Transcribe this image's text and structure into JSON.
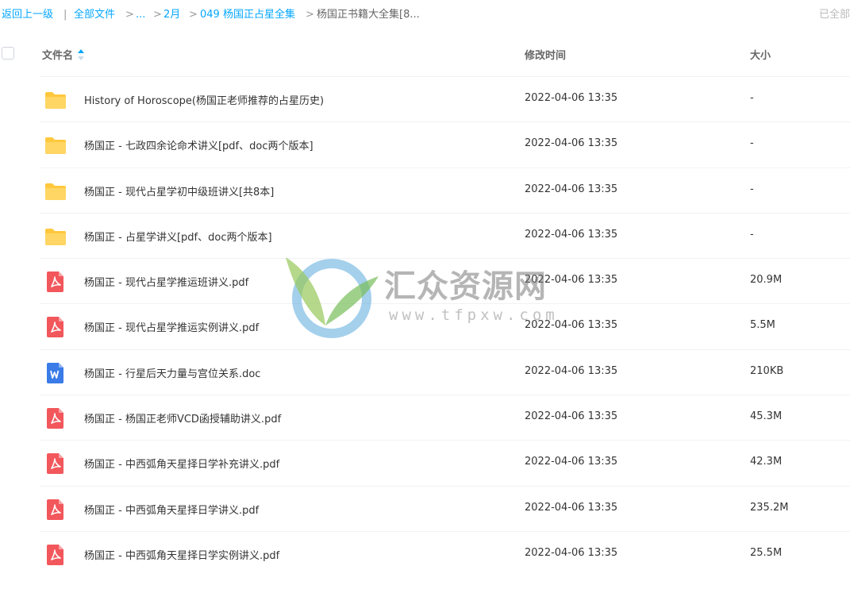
{
  "breadcrumb": {
    "back": "返回上一级",
    "divider": "|",
    "all_files": "全部文件",
    "ellipsis": "...",
    "month": "2月",
    "collection": "049 杨国正占星全集",
    "current": "杨国正书籍大全集[8...",
    "arrow": ">"
  },
  "selected_count_label": "已全部",
  "table": {
    "col_name": "文件名",
    "col_time": "修改时间",
    "col_size": "大小",
    "rows": [
      {
        "icon": "folder-icon",
        "name": "History of Horoscope(杨国正老师推荐的占星历史)",
        "time": "2022-04-06 13:35",
        "size": "-"
      },
      {
        "icon": "folder-icon",
        "name": "杨国正 - 七政四余论命术讲义[pdf、doc两个版本]",
        "time": "2022-04-06 13:35",
        "size": "-"
      },
      {
        "icon": "folder-icon",
        "name": "杨国正 - 现代占星学初中级班讲义[共8本]",
        "time": "2022-04-06 13:35",
        "size": "-"
      },
      {
        "icon": "folder-icon",
        "name": "杨国正 - 占星学讲义[pdf、doc两个版本]",
        "time": "2022-04-06 13:35",
        "size": "-"
      },
      {
        "icon": "pdf-icon",
        "name": "杨国正 - 现代占星学推运班讲义.pdf",
        "time": "2022-04-06 13:35",
        "size": "20.9M"
      },
      {
        "icon": "pdf-icon",
        "name": "杨国正 - 现代占星学推运实例讲义.pdf",
        "time": "2022-04-06 13:35",
        "size": "5.5M"
      },
      {
        "icon": "doc-icon",
        "name": "杨国正 - 行星后天力量与宫位关系.doc",
        "time": "2022-04-06 13:35",
        "size": "210KB"
      },
      {
        "icon": "pdf-icon",
        "name": "杨国正 - 杨国正老师VCD函授辅助讲义.pdf",
        "time": "2022-04-06 13:35",
        "size": "45.3M"
      },
      {
        "icon": "pdf-icon",
        "name": "杨国正 - 中西弧角天星择日学补充讲义.pdf",
        "time": "2022-04-06 13:35",
        "size": "42.3M"
      },
      {
        "icon": "pdf-icon",
        "name": "杨国正 - 中西弧角天星择日学讲义.pdf",
        "time": "2022-04-06 13:35",
        "size": "235.2M"
      },
      {
        "icon": "pdf-icon",
        "name": "杨国正 - 中西弧角天星择日学实例讲义.pdf",
        "time": "2022-04-06 13:35",
        "size": "25.5M"
      }
    ]
  },
  "watermark": {
    "title": "汇众资源网",
    "url": "www.tfpxw.com"
  },
  "colors": {
    "link": "#06a7ff",
    "folder": "#ffc83d",
    "pdf": "#f2575c",
    "doc": "#3a7be8"
  }
}
